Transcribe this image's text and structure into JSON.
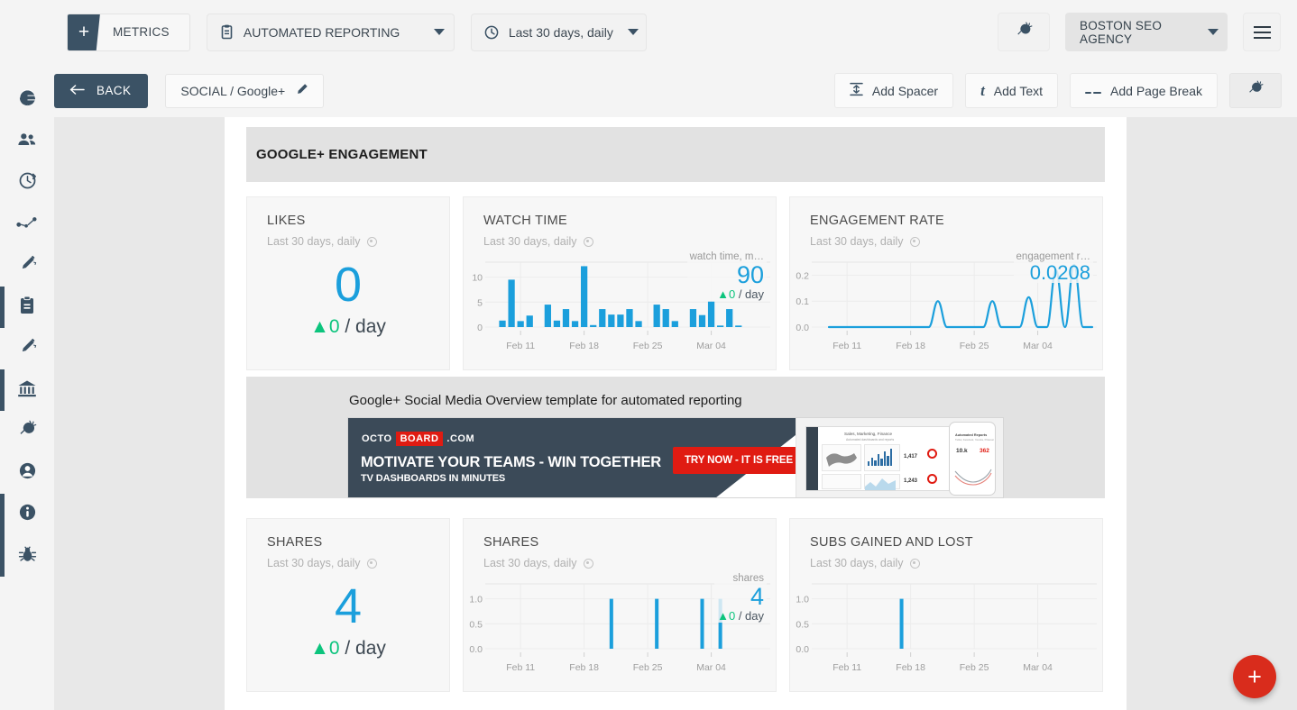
{
  "topbar": {
    "metrics_button": {
      "plus": "+",
      "label": "METRICS"
    },
    "report_select": {
      "value": "AUTOMATED REPORTING",
      "icon": "clipboard-icon"
    },
    "range_select": {
      "value": "Last 30 days, daily",
      "icon": "clock-icon"
    },
    "plugin_button_icon": "plug-icon",
    "agency_select": {
      "value": "BOSTON SEO AGENCY"
    },
    "menu_button_icon": "hamburger-icon"
  },
  "subbar": {
    "back_label": "BACK",
    "breadcrumb": "SOCIAL / Google+",
    "edit_icon": "pencil-icon",
    "add_spacer": "Add Spacer",
    "add_text": "Add Text",
    "add_page_break": "Add Page Break",
    "plug_icon": "plug-icon"
  },
  "sidebar": {
    "items": [
      {
        "name": "globe-icon",
        "active": false
      },
      {
        "name": "users-icon",
        "active": false
      },
      {
        "name": "refresh-circle-icon",
        "active": false
      },
      {
        "name": "share-nodes-icon",
        "active": false
      },
      {
        "name": "pencil-ruler-icon",
        "active": false
      },
      {
        "name": "clipboard-icon",
        "active": true
      },
      {
        "name": "pencil-ruler-icon",
        "active": false
      },
      {
        "name": "bank-icon",
        "active": true
      },
      {
        "name": "plug-icon",
        "active": false
      },
      {
        "name": "account-icon",
        "active": false
      },
      {
        "name": "info-icon",
        "active": true
      },
      {
        "name": "bug-icon",
        "active": true
      }
    ]
  },
  "canvas": {
    "section_title": "GOOGLE+ ENGAGEMENT",
    "text_widget": {
      "caption": "Google+ Social Media Overview template for automated reporting",
      "banner": {
        "brand_1": "OCTO",
        "brand_2": "BOARD",
        "brand_3": ".COM",
        "headline": "MOTIVATE YOUR TEAMS - WIN TOGETHER",
        "subhead": "TV DASHBOARDS IN MINUTES",
        "cta": "TRY NOW - IT IS FREE",
        "shot_title": "Sales, Marketing, Finance",
        "shot_subtitle": "Automated dashboards and reports",
        "shot_num_1": "1,417",
        "shot_num_2": "1,243",
        "phone_title": "Automated Reports",
        "phone_sub": "Twitter, Facebook, Youtube, Pinterest",
        "phone_num_1": "10.k",
        "phone_num_2": "362"
      }
    },
    "cards": [
      {
        "title": "LIKES",
        "subtitle": "Last 30 days, daily",
        "kind": "kpi",
        "value": "0",
        "delta": "0",
        "delta_unit": "/ day",
        "delta_dir": "up"
      },
      {
        "title": "WATCH TIME",
        "subtitle": "Last 30 days, daily",
        "kind": "chart",
        "overlay_label": "watch time, m…",
        "overlay_value": "90",
        "overlay_delta": "0",
        "overlay_delta_unit": "/ day"
      },
      {
        "title": "ENGAGEMENT RATE",
        "subtitle": "Last 30 days, daily",
        "kind": "chart",
        "overlay_label": "engagement r…",
        "overlay_value": "0.0208"
      },
      {
        "title": "SHARES",
        "subtitle": "Last 30 days, daily",
        "kind": "kpi",
        "value": "4",
        "delta": "0",
        "delta_unit": "/ day",
        "delta_dir": "up"
      },
      {
        "title": "SHARES",
        "subtitle": "Last 30 days, daily",
        "kind": "chart",
        "overlay_label": "shares",
        "overlay_value": "4",
        "overlay_delta": "0",
        "overlay_delta_unit": "/ day"
      },
      {
        "title": "SUBS GAINED AND LOST",
        "subtitle": "Last 30 days, daily",
        "kind": "chart",
        "overlay_label": "",
        "overlay_value": ""
      }
    ]
  },
  "fab": {
    "label": "+",
    "color": "#d92c1c"
  },
  "colors": {
    "accent_blue": "#1b9fdc",
    "positive_green": "#0cc47d",
    "dark_slate": "#3b5265",
    "canvas": "#ffffff",
    "page_bg": "#e8e8e8"
  },
  "chart_data": [
    {
      "id": "watch-time",
      "type": "bar",
      "title": "WATCH TIME",
      "ylabel": "watch time, minutes",
      "xlabel": "",
      "yticks": [
        0,
        5,
        10
      ],
      "ylim": [
        0,
        13
      ],
      "tick_labels": [
        "Feb 11",
        "Feb 18",
        "Feb 25",
        "Mar 04"
      ],
      "tick_positions": [
        2,
        9,
        16,
        23
      ],
      "grid": true,
      "legend": "none",
      "categories": [
        "Feb 09",
        "Feb 10",
        "Feb 11",
        "Feb 12",
        "Feb 13",
        "Feb 14",
        "Feb 15",
        "Feb 16",
        "Feb 17",
        "Feb 18",
        "Feb 19",
        "Feb 20",
        "Feb 21",
        "Feb 22",
        "Feb 23",
        "Feb 24",
        "Feb 25",
        "Feb 26",
        "Feb 27",
        "Feb 28",
        "Mar 01",
        "Mar 02",
        "Mar 03",
        "Mar 04",
        "Mar 05",
        "Mar 06",
        "Mar 07",
        "Mar 08",
        "Mar 09",
        "Mar 10"
      ],
      "values": [
        1.3,
        9.5,
        1.2,
        2.3,
        0,
        4.5,
        1.3,
        3.6,
        1.2,
        12.2,
        0.4,
        3.6,
        2.5,
        2.5,
        3.6,
        1.2,
        0,
        4.5,
        3.6,
        1.2,
        0,
        3.6,
        2.4,
        5.1,
        0.3,
        3.6,
        0.3,
        0,
        0,
        0
      ],
      "total": 90
    },
    {
      "id": "engagement-rate",
      "type": "line",
      "title": "ENGAGEMENT RATE",
      "ylabel": "engagement rate",
      "xlabel": "",
      "yticks": [
        0.0,
        0.1,
        0.2
      ],
      "ylim": [
        0,
        0.25
      ],
      "tick_labels": [
        "Feb 11",
        "Feb 18",
        "Feb 25",
        "Mar 04"
      ],
      "tick_positions": [
        2,
        9,
        16,
        23
      ],
      "grid": true,
      "legend": "none",
      "categories": [
        "Feb 09",
        "Feb 10",
        "Feb 11",
        "Feb 12",
        "Feb 13",
        "Feb 14",
        "Feb 15",
        "Feb 16",
        "Feb 17",
        "Feb 18",
        "Feb 19",
        "Feb 20",
        "Feb 21",
        "Feb 22",
        "Feb 23",
        "Feb 24",
        "Feb 25",
        "Feb 26",
        "Feb 27",
        "Feb 28",
        "Mar 01",
        "Mar 02",
        "Mar 03",
        "Mar 04",
        "Mar 05",
        "Mar 06",
        "Mar 07",
        "Mar 08",
        "Mar 09",
        "Mar 10"
      ],
      "values": [
        0,
        0,
        0,
        0,
        0,
        0,
        0,
        0,
        0,
        0,
        0,
        0,
        0.1,
        0,
        0,
        0,
        0,
        0,
        0.1,
        0,
        0,
        0,
        0.115,
        0,
        0,
        0.22,
        0,
        0.24,
        0,
        0
      ],
      "current": 0.0208
    },
    {
      "id": "shares",
      "type": "bar",
      "title": "SHARES",
      "ylabel": "shares",
      "xlabel": "",
      "yticks": [
        0.0,
        0.5,
        1.0
      ],
      "ylim": [
        0,
        1.3
      ],
      "tick_labels": [
        "Feb 11",
        "Feb 18",
        "Feb 25",
        "Mar 04"
      ],
      "tick_positions": [
        2,
        9,
        16,
        23
      ],
      "grid": true,
      "legend": "none",
      "categories": [
        "Feb 09",
        "Feb 10",
        "Feb 11",
        "Feb 12",
        "Feb 13",
        "Feb 14",
        "Feb 15",
        "Feb 16",
        "Feb 17",
        "Feb 18",
        "Feb 19",
        "Feb 20",
        "Feb 21",
        "Feb 22",
        "Feb 23",
        "Feb 24",
        "Feb 25",
        "Feb 26",
        "Feb 27",
        "Feb 28",
        "Mar 01",
        "Mar 02",
        "Mar 03",
        "Mar 04",
        "Mar 05",
        "Mar 06",
        "Mar 07",
        "Mar 08",
        "Mar 09",
        "Mar 10"
      ],
      "values": [
        0,
        0,
        0,
        0,
        0,
        0,
        0,
        0,
        0,
        0,
        0,
        0,
        1,
        0,
        0,
        0,
        0,
        1,
        0,
        0,
        0,
        0,
        1,
        0,
        1,
        0,
        0,
        0,
        0,
        0
      ],
      "total": 4
    },
    {
      "id": "subs-gained-and-lost",
      "type": "bar",
      "title": "SUBS GAINED AND LOST",
      "ylabel": "",
      "xlabel": "",
      "yticks": [
        0.0,
        0.5,
        1.0
      ],
      "ylim": [
        0,
        1.3
      ],
      "tick_labels": [
        "Feb 11",
        "Feb 18",
        "Feb 25",
        "Mar 04"
      ],
      "tick_positions": [
        2,
        9,
        16,
        23
      ],
      "grid": true,
      "legend": "none",
      "categories": [
        "Feb 09",
        "Feb 10",
        "Feb 11",
        "Feb 12",
        "Feb 13",
        "Feb 14",
        "Feb 15",
        "Feb 16",
        "Feb 17",
        "Feb 18",
        "Feb 19",
        "Feb 20",
        "Feb 21",
        "Feb 22",
        "Feb 23",
        "Feb 24",
        "Feb 25",
        "Feb 26",
        "Feb 27",
        "Feb 28",
        "Mar 01",
        "Mar 02",
        "Mar 03",
        "Mar 04",
        "Mar 05",
        "Mar 06",
        "Mar 07",
        "Mar 08",
        "Mar 09",
        "Mar 10"
      ],
      "values": [
        0,
        0,
        0,
        0,
        0,
        0,
        0,
        0,
        1,
        0,
        0,
        0,
        0,
        0,
        0,
        0,
        0,
        0,
        0,
        0,
        0,
        0,
        0,
        0,
        0,
        0,
        0,
        0,
        0,
        0
      ],
      "total": 1
    }
  ]
}
